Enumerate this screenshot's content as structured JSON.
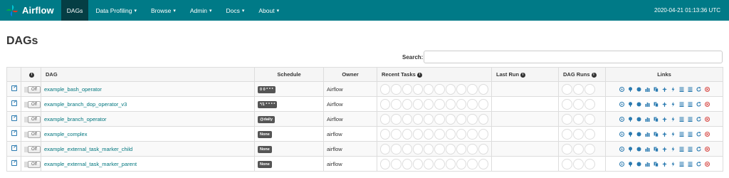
{
  "nav": {
    "brand": "Airflow",
    "items": [
      {
        "label": "DAGs",
        "active": true,
        "caret": false
      },
      {
        "label": "Data Profiling",
        "active": false,
        "caret": true
      },
      {
        "label": "Browse",
        "active": false,
        "caret": true
      },
      {
        "label": "Admin",
        "active": false,
        "caret": true
      },
      {
        "label": "Docs",
        "active": false,
        "caret": true
      },
      {
        "label": "About",
        "active": false,
        "caret": true
      }
    ],
    "clock": "2020-04-21 01:13:36 UTC"
  },
  "page": {
    "title": "DAGs",
    "search_label": "Search:",
    "search_value": ""
  },
  "table": {
    "headers": {
      "info": "i",
      "dag": "DAG",
      "schedule": "Schedule",
      "owner": "Owner",
      "recent_tasks": "Recent Tasks",
      "last_run": "Last Run",
      "dag_runs": "DAG Runs",
      "links": "Links"
    },
    "toggle_label": "Off",
    "rows": [
      {
        "dag": "example_bash_operator",
        "schedule": "0 0 * * *",
        "owner": "Airflow"
      },
      {
        "dag": "example_branch_dop_operator_v3",
        "schedule": "*/1 * * * *",
        "owner": "Airflow"
      },
      {
        "dag": "example_branch_operator",
        "schedule": "@daily",
        "owner": "Airflow"
      },
      {
        "dag": "example_complex",
        "schedule": "None",
        "owner": "airflow"
      },
      {
        "dag": "example_external_task_marker_child",
        "schedule": "None",
        "owner": "airflow"
      },
      {
        "dag": "example_external_task_marker_parent",
        "schedule": "None",
        "owner": "airflow"
      }
    ]
  },
  "colors": {
    "navbar": "#007a87",
    "active_nav": "#053e44",
    "link": "#00767e",
    "icon_blue": "#2a7ab0",
    "icon_red": "#d9534f"
  },
  "link_icons": [
    "trigger-dag-icon",
    "tree-view-icon",
    "graph-view-icon",
    "task-duration-icon",
    "task-tries-icon",
    "landing-times-icon",
    "gantt-icon",
    "code-icon",
    "logs-icon",
    "refresh-icon",
    "delete-icon"
  ]
}
